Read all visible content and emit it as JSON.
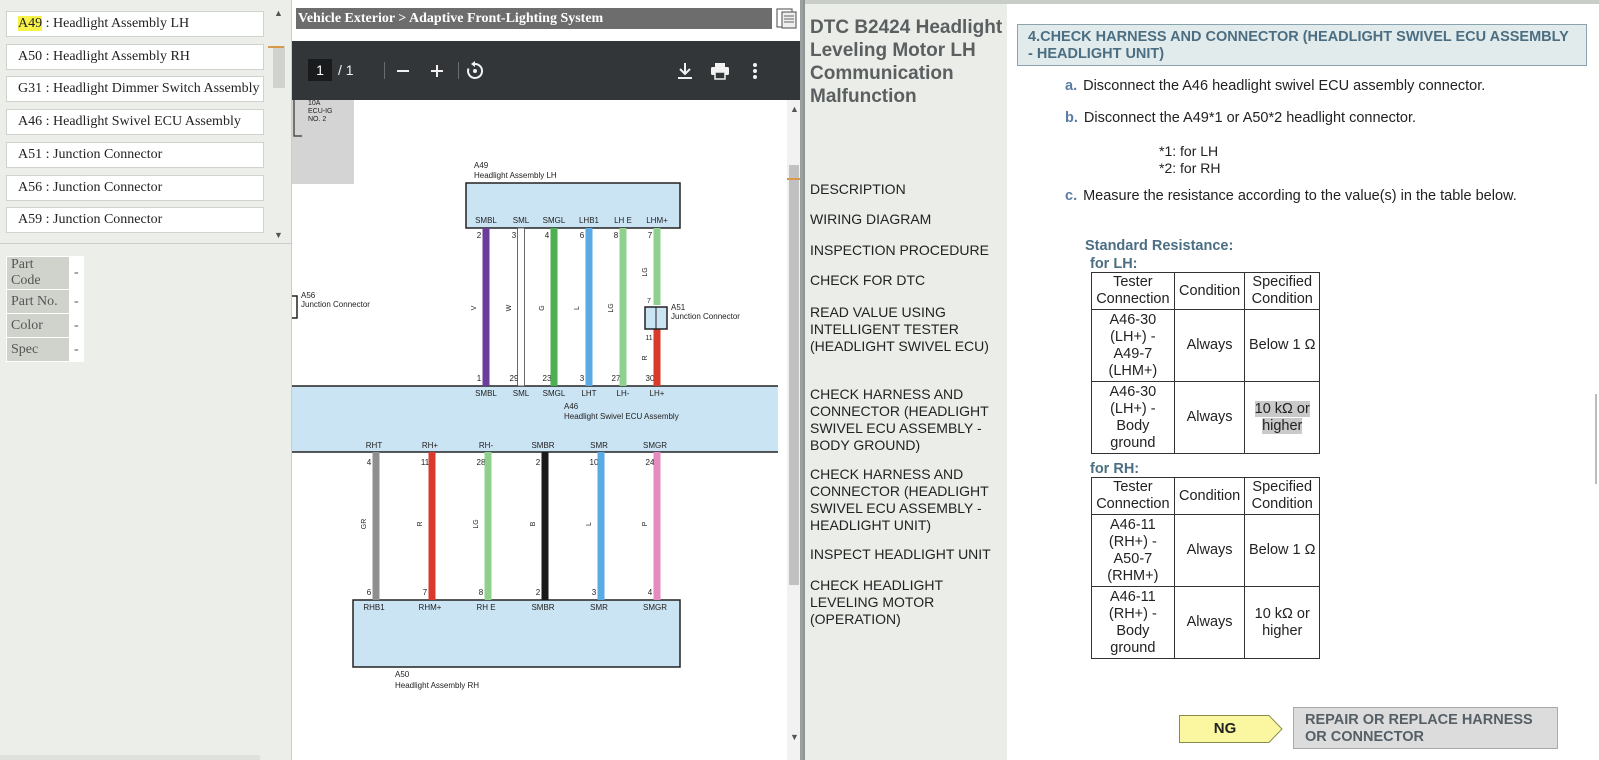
{
  "connectors": [
    {
      "code": "A49",
      "sep": " : ",
      "name": "Headlight Assembly LH",
      "highlight": true
    },
    {
      "code": "A50",
      "sep": " : ",
      "name": "Headlight Assembly RH",
      "highlight": false
    },
    {
      "code": "G31",
      "sep": " : ",
      "name": "Headlight Dimmer Switch Assembly",
      "highlight": false
    },
    {
      "code": "A46",
      "sep": " : ",
      "name": "Headlight Swivel ECU Assembly",
      "highlight": false
    },
    {
      "code": "A51",
      "sep": " : ",
      "name": "Junction Connector",
      "highlight": false
    },
    {
      "code": "A56",
      "sep": " : ",
      "name": "Junction Connector",
      "highlight": false
    },
    {
      "code": "A59",
      "sep": " : ",
      "name": "Junction Connector",
      "highlight": false
    }
  ],
  "properties": [
    {
      "key": "Part Code",
      "value": "-"
    },
    {
      "key": "Part No.",
      "value": "-"
    },
    {
      "key": "Color",
      "value": "-"
    },
    {
      "key": "Spec",
      "value": "-"
    }
  ],
  "viewer": {
    "breadcrumb": "Vehicle Exterior > Adaptive Front-Lighting System",
    "page_current": "1",
    "page_total": "/ 1",
    "icons": {
      "zoom_out": "minus-icon",
      "zoom_in": "plus-icon",
      "rotate": "rotate-icon",
      "download": "download-icon",
      "print": "print-icon",
      "more": "more-vert-icon"
    }
  },
  "diagram": {
    "fuse": {
      "rating": "10A",
      "name1": "ECU-IG",
      "name2": "NO. 2"
    },
    "a49": {
      "code": "A49",
      "name": "Headlight Assembly LH",
      "pins": [
        {
          "label": "SMBL",
          "num": "2",
          "bottom": "1",
          "blabel": "SMBL",
          "wire": "V",
          "color": "#6a3d9a"
        },
        {
          "label": "SML",
          "num": "3",
          "bottom": "29",
          "blabel": "SML",
          "wire": "W",
          "color": "#ffffff"
        },
        {
          "label": "SMGL",
          "num": "4",
          "bottom": "23",
          "blabel": "SMGL",
          "wire": "G",
          "color": "#4caf50"
        },
        {
          "label": "LHB1",
          "num": "6",
          "bottom": "3",
          "blabel": "LHT",
          "wire": "L",
          "color": "#5aaae6"
        },
        {
          "label": "LH E",
          "num": "8",
          "bottom": "27",
          "blabel": "LH-",
          "wire": "LG",
          "color": "#8fd08f"
        },
        {
          "label": "LHM+",
          "num": "7",
          "bottom": "30",
          "blabel": "LH+",
          "wire": "LG",
          "color": "#8fd08f"
        }
      ]
    },
    "a51": {
      "code": "A51",
      "name": "Junction Connector",
      "pin_top": "7",
      "pin_bottom": "11",
      "wire_below": "R"
    },
    "a56": {
      "code": "A56",
      "name": "Junction Connector"
    },
    "a46": {
      "code": "A46",
      "name": "Headlight Swivel ECU Assembly"
    },
    "a50": {
      "code": "A50",
      "name": "Headlight Assembly RH",
      "pins": [
        {
          "label": "RHT",
          "num": "4",
          "bottom": "6",
          "blabel": "RHB1",
          "wire": "GR",
          "color": "#8f8f8f"
        },
        {
          "label": "RH+",
          "num": "11",
          "bottom": "7",
          "blabel": "RHM+",
          "wire": "R",
          "color": "#d93a2b"
        },
        {
          "label": "RH-",
          "num": "28",
          "bottom": "8",
          "blabel": "RH E",
          "wire": "LG",
          "color": "#8fd08f"
        },
        {
          "label": "SMBR",
          "num": "2",
          "bottom": "2",
          "blabel": "SMBR",
          "wire": "B",
          "color": "#1a1a1a"
        },
        {
          "label": "SMR",
          "num": "10",
          "bottom": "3",
          "blabel": "SMR",
          "wire": "L",
          "color": "#5aaae6"
        },
        {
          "label": "SMGR",
          "num": "24",
          "bottom": "4",
          "blabel": "SMGR",
          "wire": "P",
          "color": "#e58bbf"
        }
      ]
    }
  },
  "nav": {
    "title": "DTC    B2424 Headlight Leveling Motor LH Communication Malfunction",
    "links": [
      "DESCRIPTION",
      "WIRING DIAGRAM",
      "INSPECTION PROCEDURE",
      "CHECK FOR DTC",
      "READ VALUE USING INTELLIGENT TESTER (HEADLIGHT SWIVEL ECU)",
      "CHECK HARNESS AND CONNECTOR (HEADLIGHT SWIVEL ECU ASSEMBLY - BODY GROUND)",
      "CHECK HARNESS AND CONNECTOR (HEADLIGHT SWIVEL ECU ASSEMBLY - HEADLIGHT UNIT)",
      "INSPECT HEADLIGHT UNIT",
      "CHECK HEADLIGHT LEVELING MOTOR (OPERATION)"
    ]
  },
  "content": {
    "step_title": "4.CHECK HARNESS AND CONNECTOR (HEADLIGHT SWIVEL ECU ASSEMBLY - HEADLIGHT UNIT)",
    "steps": [
      {
        "letter": "a.",
        "text": "Disconnect the A46 headlight swivel ECU assembly connector."
      },
      {
        "letter": "b.",
        "text": "Disconnect the A49*1 or A50*2 headlight connector."
      },
      {
        "letter": "c.",
        "text": "Measure the resistance according to the value(s) in the table below."
      }
    ],
    "notes": [
      "*1: for LH",
      "*2: for RH"
    ],
    "std_title": "Standard Resistance:",
    "lh_label": "for LH:",
    "rh_label": "for RH:",
    "table_headers": [
      "Tester Connection",
      "Condition",
      "Specified Condition"
    ],
    "lh_rows": [
      {
        "conn": "A46-30 (LH+) - A49-7 (LHM+)",
        "cond": "Always",
        "spec": "Below 1 Ω",
        "shaded": false
      },
      {
        "conn": "A46-30 (LH+) - Body ground",
        "cond": "Always",
        "spec": "10 kΩ or higher",
        "shaded": true
      }
    ],
    "rh_rows": [
      {
        "conn": "A46-11 (RH+) - A50-7 (RHM+)",
        "cond": "Always",
        "spec": "Below 1 Ω",
        "shaded": false
      },
      {
        "conn": "A46-11 (RH+) - Body ground",
        "cond": "Always",
        "spec": "10 kΩ or higher",
        "shaded": false
      }
    ],
    "ng_label": "NG",
    "repair_label": "REPAIR OR REPLACE HARNESS OR CONNECTOR"
  }
}
